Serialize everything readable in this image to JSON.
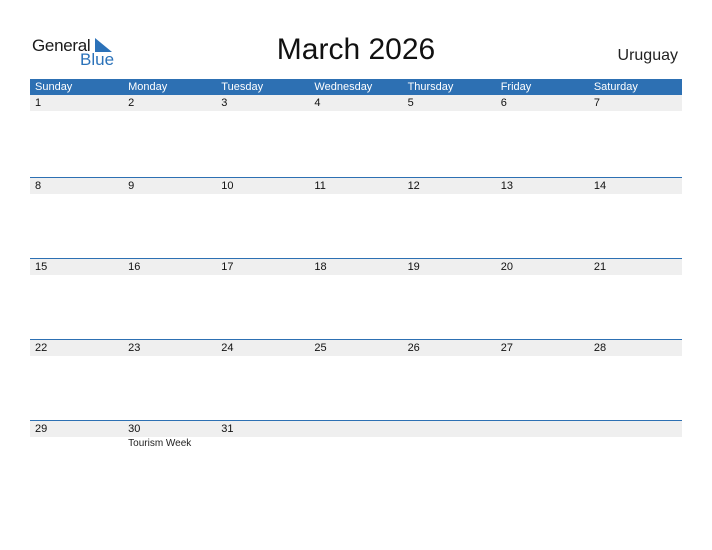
{
  "logo": {
    "general": "General",
    "blue": "Blue"
  },
  "title": "March 2026",
  "country": "Uruguay",
  "weekdays": [
    "Sunday",
    "Monday",
    "Tuesday",
    "Wednesday",
    "Thursday",
    "Friday",
    "Saturday"
  ],
  "weeks": [
    {
      "days": [
        "1",
        "2",
        "3",
        "4",
        "5",
        "6",
        "7"
      ],
      "events": [
        "",
        "",
        "",
        "",
        "",
        "",
        ""
      ]
    },
    {
      "days": [
        "8",
        "9",
        "10",
        "11",
        "12",
        "13",
        "14"
      ],
      "events": [
        "",
        "",
        "",
        "",
        "",
        "",
        ""
      ]
    },
    {
      "days": [
        "15",
        "16",
        "17",
        "18",
        "19",
        "20",
        "21"
      ],
      "events": [
        "",
        "",
        "",
        "",
        "",
        "",
        ""
      ]
    },
    {
      "days": [
        "22",
        "23",
        "24",
        "25",
        "26",
        "27",
        "28"
      ],
      "events": [
        "",
        "",
        "",
        "",
        "",
        "",
        ""
      ]
    },
    {
      "days": [
        "29",
        "30",
        "31",
        "",
        "",
        "",
        ""
      ],
      "events": [
        "",
        "Tourism Week",
        "",
        "",
        "",
        "",
        ""
      ]
    }
  ],
  "colors": {
    "accent": "#2d70b3",
    "strip": "#efefef"
  }
}
